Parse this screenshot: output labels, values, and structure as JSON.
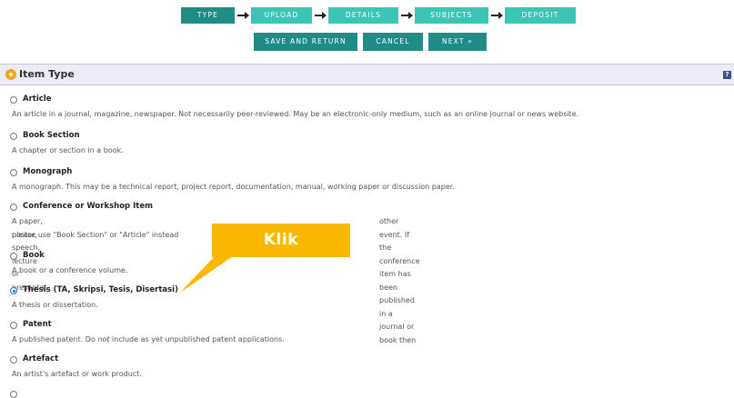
{
  "steps": [
    {
      "label": "TYPE",
      "active": true
    },
    {
      "label": "UPLOAD",
      "active": false
    },
    {
      "label": "DETAILS",
      "active": false
    },
    {
      "label": "SUBJECTS",
      "active": false
    },
    {
      "label": "DEPOSIT",
      "active": false
    }
  ],
  "actions": {
    "save_return": "SAVE AND RETURN",
    "cancel": "CANCEL",
    "next": "NEXT »"
  },
  "panel": {
    "title": "Item Type",
    "help": "?"
  },
  "options": [
    {
      "title": "Article",
      "desc": "An article in a journal, magazine, newspaper. Not necessarily peer-reviewed. May be an electronic-only medium, such as an online journal or news website.",
      "selected": false
    },
    {
      "title": "Book Section",
      "desc": "A chapter or section in a book.",
      "selected": false
    },
    {
      "title": "Monograph",
      "desc": "A monograph. This may be a technical report, project report, documentation, manual, working paper or discussion paper.",
      "selected": false
    },
    {
      "title": "Conference or Workshop Item",
      "desc_line1_left": "A paper, poster, speech, lecture or presentat",
      "desc_line1_right": "other event. If the conference item has been published in a journal or book then",
      "desc_line2": "please use \"Book Section\" or \"Article\" instead",
      "selected": false
    },
    {
      "title": "Book",
      "desc": "A book or a conference volume.",
      "selected": false
    },
    {
      "title": "Thesis (TA, Skripsi, Tesis, Disertasi)",
      "desc": "A thesis or dissertation.",
      "selected": true
    },
    {
      "title": "Patent",
      "desc_before": "A published patent. Do ",
      "desc_em": "not",
      "desc_after": " include as yet unpublished patent applications.",
      "selected": false
    },
    {
      "title": "Artefact",
      "desc": "An artist's artefact or work product.",
      "selected": false
    }
  ],
  "callout": {
    "text": "Klik"
  },
  "colors": {
    "step_active": "#1f8c85",
    "step_inactive": "#3cc4b5",
    "callout": "#fbb800",
    "header_bg": "#ececf6"
  }
}
